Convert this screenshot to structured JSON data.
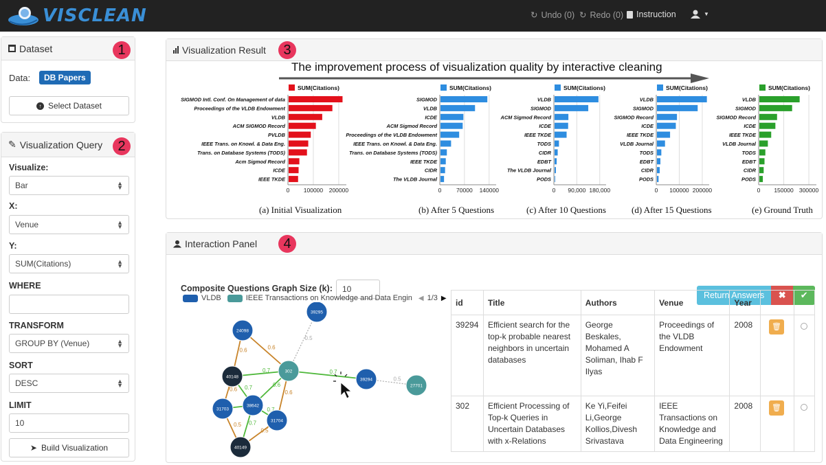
{
  "app": {
    "logo_text": "VISCLEAN"
  },
  "navbar": {
    "undo": "Undo (0)",
    "redo": "Redo (0)",
    "instruction": "Instruction"
  },
  "dataset_panel": {
    "title": "Dataset",
    "marker": "1",
    "data_label": "Data:",
    "data_value": "DB Papers",
    "select_button": "Select Dataset"
  },
  "query_panel": {
    "title": "Visualization Query",
    "marker": "2",
    "visualize_label": "Visualize:",
    "visualize_value": "Bar",
    "x_label": "X:",
    "x_value": "Venue",
    "y_label": "Y:",
    "y_value": "SUM(Citations)",
    "where_label": "WHERE",
    "where_value": "",
    "transform_label": "TRANSFORM",
    "transform_value": "GROUP BY (Venue)",
    "sort_label": "SORT",
    "sort_value": "DESC",
    "limit_label": "LIMIT",
    "limit_value": "10",
    "build_button": "Build Visualization"
  },
  "result_panel": {
    "title": "Visualization Result",
    "marker": "3",
    "banner": "The improvement process of visualization quality by interactive cleaning"
  },
  "chart_data": [
    {
      "type": "bar",
      "orientation": "horizontal",
      "caption": "(a) Initial Visualization",
      "legend": "SUM(Citations)",
      "color": "#e3111b",
      "categories": [
        "SIGMOD Intl. Conf. On Management of data",
        "Proceedings of the VLDB Endowment",
        "VLDB",
        "ACM SIGMOD Record",
        "PVLDB",
        "IEEE Trans. on Knowl. & Data Eng.",
        "Trans. on Database Systems (TODS)",
        "Acm Sigmod Record",
        "ICDE",
        "IEEE TKDE"
      ],
      "values": [
        215000,
        175000,
        135000,
        110000,
        90000,
        80000,
        75000,
        45000,
        42000,
        40000
      ],
      "xlim": [
        0,
        230000
      ],
      "ticks": [
        0,
        100000,
        200000
      ],
      "tick_labels": [
        "0",
        "100000",
        "200000"
      ]
    },
    {
      "type": "bar",
      "orientation": "horizontal",
      "caption": "(b) After 5 Questions",
      "legend": "SUM(Citations)",
      "color": "#2e8de0",
      "categories": [
        "SIGMOD",
        "VLDB",
        "ICDE",
        "ACM Sigmod Record",
        "Proceedings of the VLDB Endowment",
        "IEEE Trans. on Knowl. & Data Eng.",
        "Trans. on Database Systems (TODS)",
        "IEEE TKDE",
        "CIDR",
        "The VLDB Journal"
      ],
      "values": [
        135000,
        100000,
        67000,
        65000,
        55000,
        32000,
        20000,
        17000,
        15000,
        12000
      ],
      "xlim": [
        0,
        160000
      ],
      "ticks": [
        0,
        70000,
        140000
      ],
      "tick_labels": [
        "0",
        "70000",
        "140000"
      ]
    },
    {
      "type": "bar",
      "orientation": "horizontal",
      "caption": "(c) After 10 Questions",
      "legend": "SUM(Citations)",
      "color": "#2e8de0",
      "categories": [
        "VLDB",
        "SIGMOD",
        "ACM Sigmod Record",
        "ICDE",
        "IEEE TKDE",
        "TODS",
        "CIDR",
        "EDBT",
        "The VLDB Journal",
        "PODS"
      ],
      "values": [
        175000,
        135000,
        57000,
        56000,
        50000,
        20000,
        15000,
        11000,
        8000,
        5000
      ],
      "xlim": [
        0,
        205000
      ],
      "ticks": [
        0,
        90000,
        180000
      ],
      "tick_labels": [
        "0",
        "90,000",
        "180,000"
      ]
    },
    {
      "type": "bar",
      "orientation": "horizontal",
      "caption": "(d) After 15 Questions",
      "legend": "SUM(Citations)",
      "color": "#2e8de0",
      "categories": [
        "VLDB",
        "SIGMOD",
        "SIGMOD Record",
        "ICDE",
        "IEEE TKDE",
        "VLDB Journal",
        "TODS",
        "EDBT",
        "CIDR",
        "PODS"
      ],
      "values": [
        220000,
        180000,
        90000,
        85000,
        60000,
        38000,
        22000,
        18000,
        15000,
        10000
      ],
      "xlim": [
        0,
        230000
      ],
      "ticks": [
        0,
        100000,
        200000
      ],
      "tick_labels": [
        "0",
        "100000",
        "200000"
      ]
    },
    {
      "type": "bar",
      "orientation": "horizontal",
      "caption": "(e) Ground Truth",
      "legend": "SUM(Citations)",
      "color": "#2aa02b",
      "categories": [
        "VLDB",
        "SIGMOD",
        "SIGMOD Record",
        "ICDE",
        "IEEE TKDE",
        "VLDB Journal",
        "TODS",
        "EDBT",
        "CIDR",
        "PODS"
      ],
      "values": [
        245000,
        200000,
        110000,
        100000,
        75000,
        55000,
        40000,
        35000,
        30000,
        25000
      ],
      "xlim": [
        0,
        345000
      ],
      "ticks": [
        0,
        150000,
        300000
      ],
      "tick_labels": [
        "0",
        "150000",
        "300000"
      ]
    }
  ],
  "interaction_panel": {
    "title": "Interaction Panel",
    "marker": "4",
    "k_label": "Composite Questions Graph Size (k):",
    "k_value": "10",
    "return_button": "Return Answers",
    "legend_items": [
      "VLDB",
      "IEEE Transactions on Knowledge and Data Engin"
    ],
    "legend_page": "1/3",
    "graph": {
      "nodes": [
        {
          "id": "39295",
          "color": "#1f5fad"
        },
        {
          "id": "24098",
          "color": "#1f5fad"
        },
        {
          "id": "302",
          "color": "#4a9a9a"
        },
        {
          "id": "40148",
          "color": "#1b2b3b"
        },
        {
          "id": "39294",
          "color": "#1f5fad"
        },
        {
          "id": "27701",
          "color": "#4a9a9a"
        },
        {
          "id": "38642",
          "color": "#1f5fad"
        },
        {
          "id": "31703",
          "color": "#1f5fad"
        },
        {
          "id": "31704",
          "color": "#1f5fad"
        },
        {
          "id": "40149",
          "color": "#1b2b3b"
        }
      ],
      "edges": [
        {
          "from": "302",
          "to": "39295",
          "label": "0.5",
          "kind": "gray"
        },
        {
          "from": "302",
          "to": "24098",
          "label": "0.6",
          "kind": "brown"
        },
        {
          "from": "302",
          "to": "39294",
          "label": "0.7",
          "kind": "green"
        },
        {
          "from": "39294",
          "to": "27701",
          "label": "0.5",
          "kind": "gray"
        },
        {
          "from": "24098",
          "to": "40148",
          "label": "0.6",
          "kind": "brown"
        },
        {
          "from": "302",
          "to": "40148",
          "label": "0.7",
          "kind": "green"
        },
        {
          "from": "302",
          "to": "38642",
          "label": "0.6",
          "kind": "green"
        },
        {
          "from": "302",
          "to": "31704",
          "label": "0.6",
          "kind": "brown"
        },
        {
          "from": "40148",
          "to": "31703",
          "label": "0.6",
          "kind": "brown"
        },
        {
          "from": "40148",
          "to": "38642",
          "label": "0.7",
          "kind": "green"
        },
        {
          "from": "38642",
          "to": "31703",
          "label": "",
          "kind": "green"
        },
        {
          "from": "38642",
          "to": "31704",
          "label": "0.7",
          "kind": "green"
        },
        {
          "from": "31703",
          "to": "40149",
          "label": "0.5",
          "kind": "brown"
        },
        {
          "from": "38642",
          "to": "40149",
          "label": "0.7",
          "kind": "green"
        },
        {
          "from": "31704",
          "to": "40149",
          "label": "0.5",
          "kind": "brown"
        }
      ]
    },
    "table": {
      "headers": [
        "id",
        "Title",
        "Authors",
        "Venue",
        "Year",
        "",
        ""
      ],
      "rows": [
        {
          "id": "39294",
          "title": "Efficient search for the top-k probable nearest neighbors in uncertain databases",
          "authors": "George Beskales, Mohamed A Soliman, Ihab F Ilyas",
          "venue": "Proceedings of the VLDB Endowment",
          "year": "2008"
        },
        {
          "id": "302",
          "title": "Efficient Processing of Top-k Queries in Uncertain Databases with x-Relations",
          "authors": "Ke Yi,Feifei Li,George Kollios,Divesh Srivastava",
          "venue": "IEEE Transactions on Knowledge and Data Engineering",
          "year": "2008"
        }
      ]
    }
  }
}
